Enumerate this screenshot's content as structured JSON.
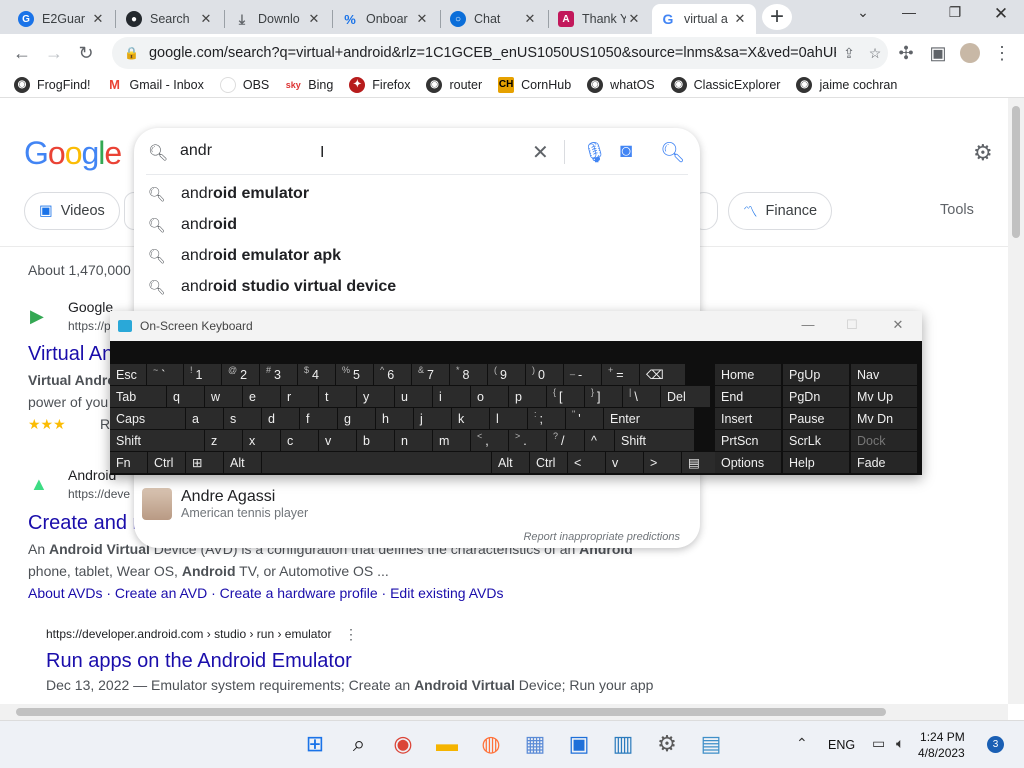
{
  "browser": {
    "tabs": [
      {
        "title": "E2Guar",
        "icon": "shield-icon",
        "color": "#1a73e8"
      },
      {
        "title": "Search",
        "icon": "github-icon",
        "color": "#24292e"
      },
      {
        "title": "Downlo",
        "icon": "download-icon",
        "color": "#5f6368"
      },
      {
        "title": "Onboar",
        "icon": "onboard-icon",
        "color": "#1a73e8"
      },
      {
        "title": "Chat",
        "icon": "chat-icon",
        "color": "#0b6ed9"
      },
      {
        "title": "Thank Y",
        "icon": "angular-icon",
        "color": "#c2185b"
      },
      {
        "title": "virtual a",
        "icon": "google-icon",
        "color": "#4285f4"
      }
    ],
    "url": "google.com/search?q=virtual+android&rlz=1C1GCEB_enUS1050US1050&source=lnms&sa=X&ved=0ahUK...",
    "bookmarks": [
      {
        "label": "FrogFind!",
        "color": "#333"
      },
      {
        "label": "Gmail - Inbox",
        "color": "#ea4335"
      },
      {
        "label": "OBS",
        "color": "#444"
      },
      {
        "label": "Bing",
        "color": "#d33"
      },
      {
        "label": "Firefox",
        "color": "#b71c1c"
      },
      {
        "label": "router",
        "color": "#333"
      },
      {
        "label": "CornHub",
        "color": "#e6a100"
      },
      {
        "label": "whatOS",
        "color": "#333"
      },
      {
        "label": "ClassicExplorer",
        "color": "#333"
      },
      {
        "label": "jaime cochran",
        "color": "#333"
      }
    ]
  },
  "google": {
    "query": "andr",
    "suggestions": [
      {
        "prefix": "andr",
        "rest": "oid emulator"
      },
      {
        "prefix": "andr",
        "rest": "oid"
      },
      {
        "prefix": "andr",
        "rest": "oid emulator apk"
      },
      {
        "prefix": "andr",
        "rest": "oid studio virtual device"
      }
    ],
    "entity": {
      "name": "Andre Agassi",
      "desc": "American tennis player"
    },
    "report": "Report inappropriate predictions",
    "chips": {
      "videos": "Videos",
      "finance": "Finance",
      "tools": "Tools",
      "partial": "s"
    },
    "results": {
      "about": "About 1,470,000",
      "r1_site": "Google",
      "r1_cite": "https://p",
      "r1_title": "Virtual An",
      "r1_snip1": "Virtual Andro",
      "r1_snip2": "power of you",
      "r1_rating": "★★★",
      "r1_extra": "R",
      "r2_site": "Android",
      "r2_cite": "https://deve",
      "r2_title": "Create and n",
      "r2_snip1_a": "An ",
      "r2_snip1_b": "Android Virtual",
      "r2_snip1_c": " Device (AVD) is a configuration that defines the characteristics of an ",
      "r2_snip1_d": "Android",
      "r2_snip2_a": "phone, tablet, Wear OS, ",
      "r2_snip2_b": "Android",
      "r2_snip2_c": " TV, or Automotive OS ...",
      "r2_sitelinks": "About AVDs · Create an AVD · Create a hardware profile · Edit existing AVDs",
      "r3_cite": "https://developer.android.com › studio › run › emulator",
      "r3_title": "Run apps on the Android Emulator",
      "r3_snip_a": "Dec 13, 2022 — Emulator system requirements; Create an ",
      "r3_snip_b": "Android Virtual",
      "r3_snip_c": " Device; Run your app"
    }
  },
  "osk": {
    "title": "On-Screen Keyboard",
    "rows": [
      [
        {
          "l": "Esc"
        },
        {
          "s": "~",
          "l": "`"
        },
        {
          "s": "!",
          "l": "1"
        },
        {
          "s": "@",
          "l": "2"
        },
        {
          "s": "#",
          "l": "3"
        },
        {
          "s": "$",
          "l": "4"
        },
        {
          "s": "%",
          "l": "5"
        },
        {
          "s": "^",
          "l": "6"
        },
        {
          "s": "&",
          "l": "7"
        },
        {
          "s": "*",
          "l": "8"
        },
        {
          "s": "(",
          "l": "9"
        },
        {
          "s": ")",
          "l": "0"
        },
        {
          "s": "_",
          "l": "-"
        },
        {
          "s": "+",
          "l": "="
        },
        {
          "l": "⌫"
        },
        {
          "l": "Home"
        },
        {
          "l": "PgUp"
        },
        {
          "l": "Nav"
        }
      ],
      [
        {
          "l": "Tab"
        },
        {
          "l": "q"
        },
        {
          "l": "w"
        },
        {
          "l": "e"
        },
        {
          "l": "r"
        },
        {
          "l": "t"
        },
        {
          "l": "y"
        },
        {
          "l": "u"
        },
        {
          "l": "i"
        },
        {
          "l": "o"
        },
        {
          "l": "p"
        },
        {
          "s": "{",
          "l": "["
        },
        {
          "s": "}",
          "l": "]"
        },
        {
          "s": "|",
          "l": "\\"
        },
        {
          "l": "Del"
        },
        {
          "l": "End"
        },
        {
          "l": "PgDn"
        },
        {
          "l": "Mv Up"
        }
      ],
      [
        {
          "l": "Caps"
        },
        {
          "l": "a"
        },
        {
          "l": "s"
        },
        {
          "l": "d"
        },
        {
          "l": "f"
        },
        {
          "l": "g"
        },
        {
          "l": "h"
        },
        {
          "l": "j"
        },
        {
          "l": "k"
        },
        {
          "l": "l"
        },
        {
          "s": ":",
          "l": ";"
        },
        {
          "s": "\"",
          "l": "'"
        },
        {
          "l": "Enter"
        },
        {
          "l": "Insert"
        },
        {
          "l": "Pause"
        },
        {
          "l": "Mv Dn"
        }
      ],
      [
        {
          "l": "Shift"
        },
        {
          "l": "z"
        },
        {
          "l": "x"
        },
        {
          "l": "c"
        },
        {
          "l": "v"
        },
        {
          "l": "b"
        },
        {
          "l": "n"
        },
        {
          "l": "m"
        },
        {
          "s": "<",
          "l": ","
        },
        {
          "s": ">",
          "l": "."
        },
        {
          "s": "?",
          "l": "/"
        },
        {
          "l": "^"
        },
        {
          "l": "Shift"
        },
        {
          "l": "PrtScn"
        },
        {
          "l": "ScrLk"
        },
        {
          "l": "Dock"
        }
      ],
      [
        {
          "l": "Fn"
        },
        {
          "l": "Ctrl"
        },
        {
          "l": "⊞"
        },
        {
          "l": "Alt"
        },
        {
          "l": ""
        },
        {
          "l": "Alt"
        },
        {
          "l": "Ctrl"
        },
        {
          "l": "<"
        },
        {
          "l": "v"
        },
        {
          "l": ">"
        },
        {
          "l": "▤"
        },
        {
          "l": "Options"
        },
        {
          "l": "Help"
        },
        {
          "l": "Fade"
        }
      ]
    ]
  },
  "taskbar": {
    "time": "1:24 PM",
    "date": "4/8/2023",
    "lang": "ENG",
    "notifications": "3",
    "apps": [
      {
        "name": "windows-start",
        "color": "#1a73e8"
      },
      {
        "name": "search",
        "color": "#222"
      },
      {
        "name": "chrome",
        "color": "#db4437"
      },
      {
        "name": "file-explorer",
        "color": "#f5b400"
      },
      {
        "name": "firefox",
        "color": "#ff7139"
      },
      {
        "name": "photos",
        "color": "#5b8bd6"
      },
      {
        "name": "store",
        "color": "#1e6fd9"
      },
      {
        "name": "remote",
        "color": "#2b7bbd"
      },
      {
        "name": "settings",
        "color": "#5a5a5a"
      },
      {
        "name": "control-panel",
        "color": "#3f8fc8"
      }
    ]
  }
}
